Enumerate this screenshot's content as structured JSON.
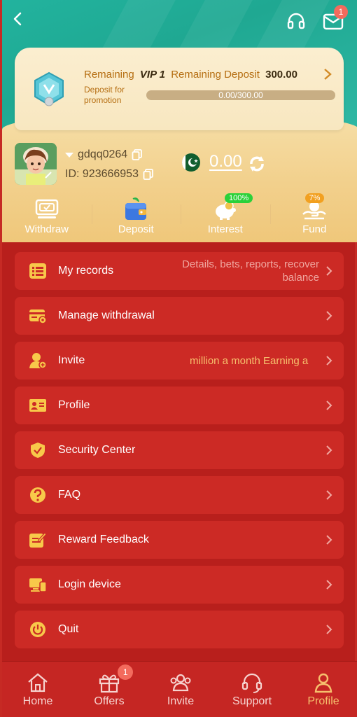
{
  "header": {
    "mail_badge": "1"
  },
  "vip": {
    "remaining_label": "Remaining",
    "level": "VIP 1",
    "deposit_label": "Remaining Deposit",
    "amount": "300.00",
    "promo_text": "Deposit for promotion",
    "progress_text": "0.00/300.00",
    "progress_fraction": 0.0
  },
  "user": {
    "username": "gdqq0264",
    "id_text": "ID: 923666953",
    "balance": "0.00",
    "country": "Pakistan flag"
  },
  "actions": [
    {
      "label": "Withdraw",
      "icon": "withdraw-icon"
    },
    {
      "label": "Deposit",
      "icon": "wallet-icon"
    },
    {
      "label": "Interest",
      "icon": "piggy-bank-icon",
      "badge": "100%",
      "badge_color": "#2bd13a"
    },
    {
      "label": "Fund",
      "icon": "fund-icon",
      "badge": "7%",
      "badge_color": "#f2a020"
    }
  ],
  "menu": [
    {
      "label": "My records",
      "hint": "Details, bets, reports, recover balance",
      "icon": "records-icon"
    },
    {
      "label": "Manage withdrawal",
      "hint": "",
      "icon": "card-icon"
    },
    {
      "label": "Invite",
      "hint": "million a month  Earning a",
      "icon": "invite-icon"
    },
    {
      "label": "Profile",
      "hint": "",
      "icon": "profile-card-icon"
    },
    {
      "label": "Security Center",
      "hint": "",
      "icon": "shield-icon"
    },
    {
      "label": "FAQ",
      "hint": "",
      "icon": "question-icon"
    },
    {
      "label": "Reward Feedback",
      "hint": "",
      "icon": "feedback-icon"
    },
    {
      "label": "Login device",
      "hint": "",
      "icon": "device-icon"
    },
    {
      "label": "Quit",
      "hint": "",
      "icon": "power-icon"
    }
  ],
  "nav": [
    {
      "label": "Home",
      "icon": "home-icon"
    },
    {
      "label": "Offers",
      "icon": "gift-icon",
      "badge": "1"
    },
    {
      "label": "Invite",
      "icon": "people-icon"
    },
    {
      "label": "Support",
      "icon": "headset-icon"
    },
    {
      "label": "Profile",
      "icon": "person-icon",
      "active": true
    }
  ],
  "colors": {
    "teal": "#22b39e",
    "gold": "#f2d08c",
    "red": "#b81f1c",
    "menu_red": "#cc2a25",
    "accent_gold": "#f6c06d"
  }
}
